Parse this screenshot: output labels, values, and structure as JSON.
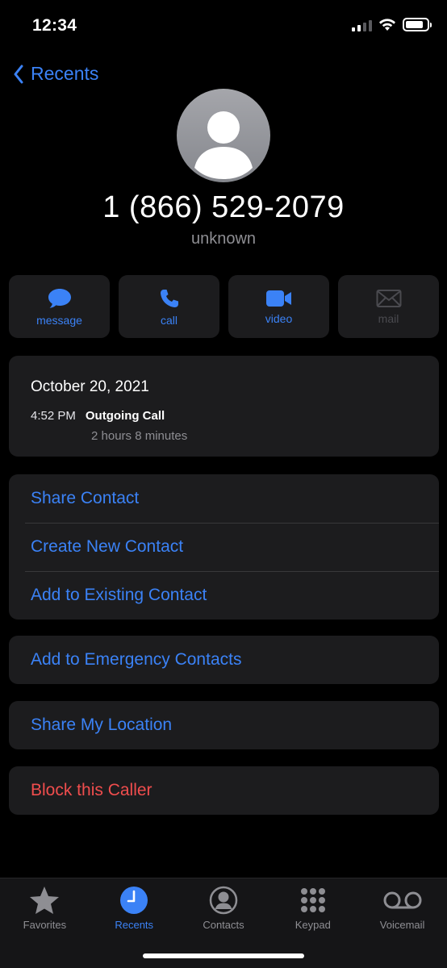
{
  "status": {
    "time": "12:34"
  },
  "nav": {
    "back_label": "Recents"
  },
  "contact": {
    "number": "1 (866) 529-2079",
    "label": "unknown"
  },
  "actions": [
    {
      "label": "message",
      "icon": "message-icon",
      "enabled": true
    },
    {
      "label": "call",
      "icon": "phone-icon",
      "enabled": true
    },
    {
      "label": "video",
      "icon": "video-icon",
      "enabled": true
    },
    {
      "label": "mail",
      "icon": "mail-icon",
      "enabled": false
    }
  ],
  "call_info": {
    "date": "October 20, 2021",
    "time": "4:52 PM",
    "type": "Outgoing Call",
    "duration": "2 hours 8 minutes"
  },
  "options": {
    "group1": [
      "Share Contact",
      "Create New Contact",
      "Add to Existing Contact"
    ],
    "emergency": "Add to Emergency Contacts",
    "location": "Share My Location",
    "block": "Block this Caller"
  },
  "tabbar": {
    "tabs": [
      {
        "label": "Favorites",
        "icon": "star-icon"
      },
      {
        "label": "Recents",
        "icon": "clock-icon",
        "active": true
      },
      {
        "label": "Contacts",
        "icon": "person-circle-icon"
      },
      {
        "label": "Keypad",
        "icon": "keypad-icon"
      },
      {
        "label": "Voicemail",
        "icon": "voicemail-icon"
      }
    ]
  },
  "colors": {
    "accent": "#3b82f6",
    "danger": "#f04d4d",
    "card": "#1c1c1e",
    "background": "#000000"
  }
}
